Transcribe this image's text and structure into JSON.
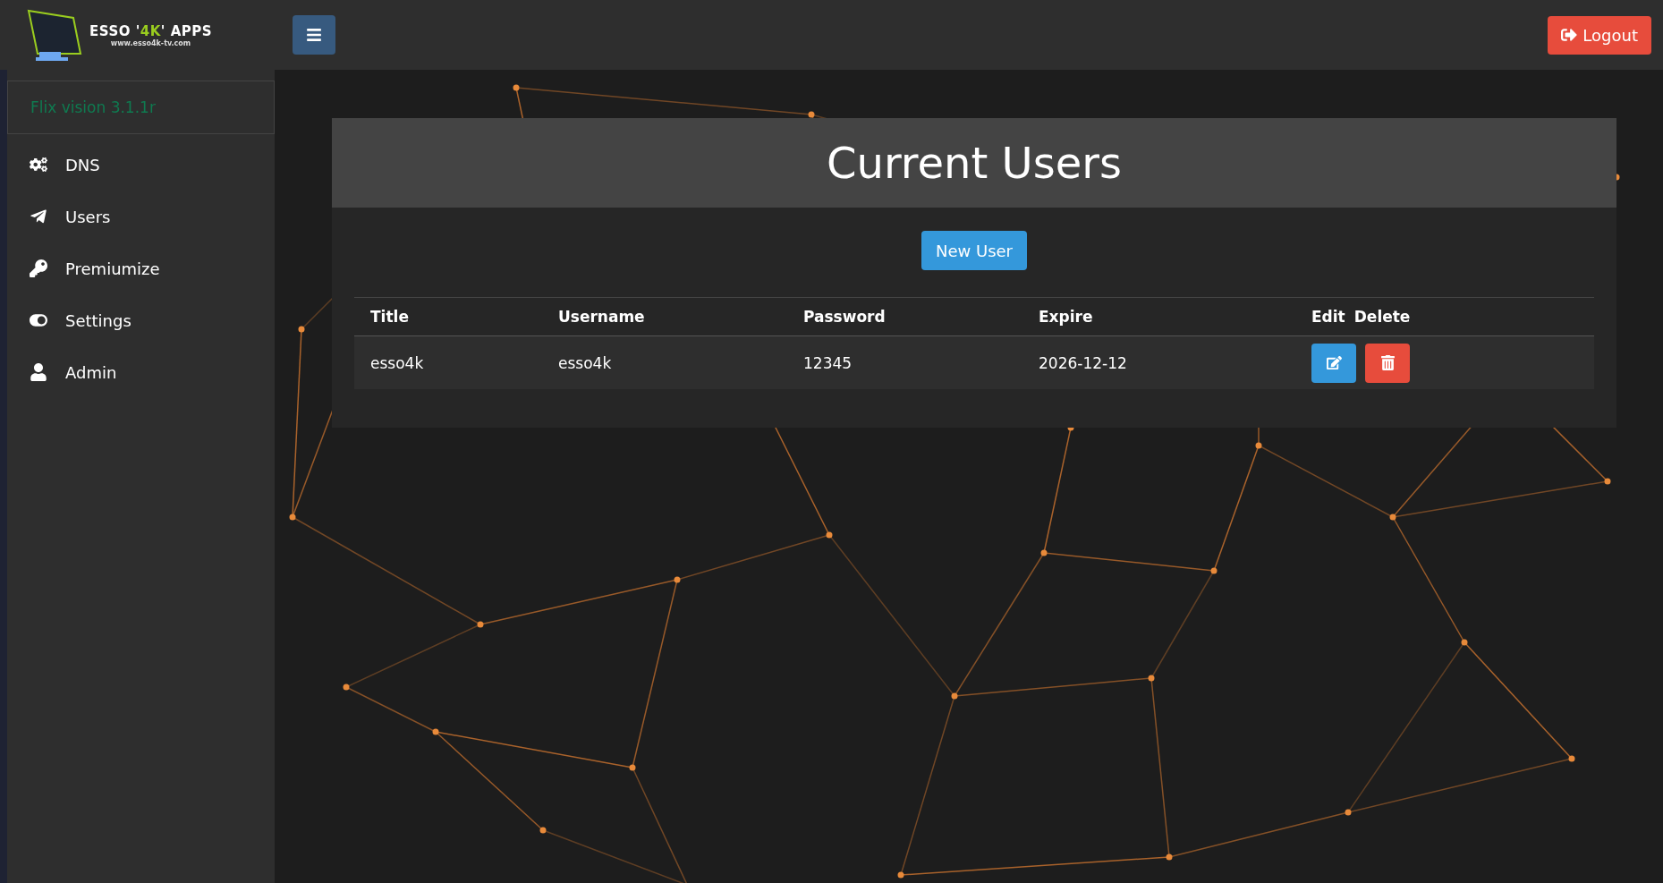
{
  "logo": {
    "before": "ESSO '",
    "highlight": "4K",
    "after": "' APPS",
    "url": "www.esso4k-tv.com"
  },
  "version": "Flix vision 3.1.1r",
  "sidebar": {
    "items": [
      {
        "kind": "dns",
        "label": "DNS"
      },
      {
        "kind": "users",
        "label": "Users"
      },
      {
        "kind": "premiumize",
        "label": "Premiumize"
      },
      {
        "kind": "settings",
        "label": "Settings"
      },
      {
        "kind": "admin",
        "label": "Admin"
      }
    ]
  },
  "logout": "Logout",
  "card": {
    "title": "Current Users",
    "new_button": "New User"
  },
  "table": {
    "columns": [
      "Title",
      "Username",
      "Password",
      "Expire",
      "Edit",
      "Delete"
    ],
    "rows": [
      {
        "title": "esso4k",
        "username": "esso4k",
        "password": "12345",
        "expire": "2026-12-12"
      }
    ]
  }
}
